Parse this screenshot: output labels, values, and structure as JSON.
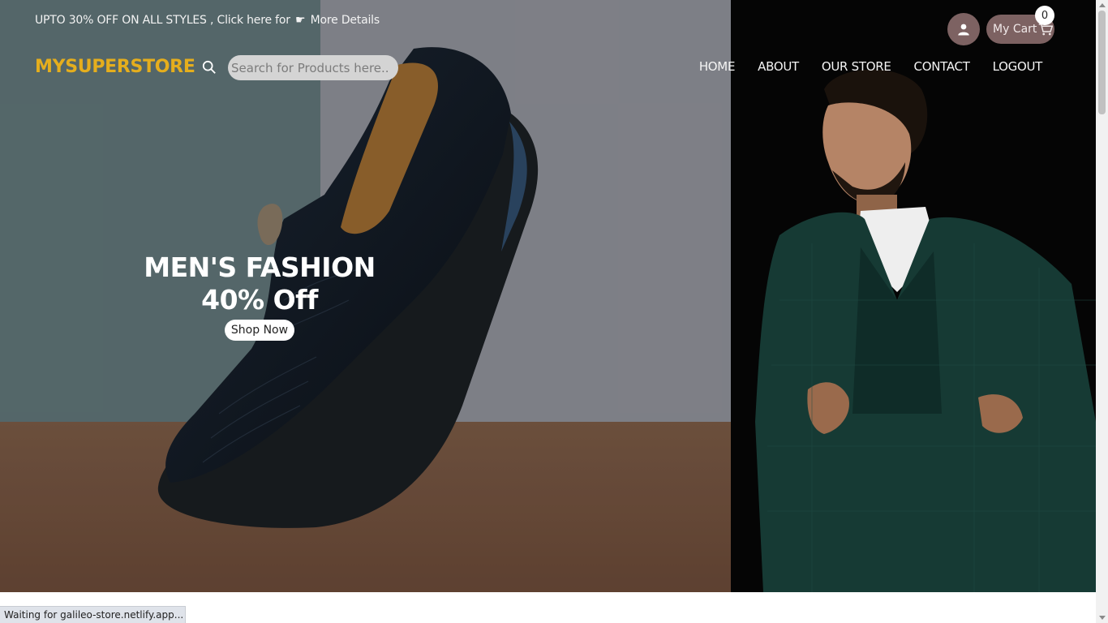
{
  "announcement": {
    "text_before": "UPTO 30% OFF ON ALL STYLES , Click here for",
    "hand_icon": "pointing-hand-icon",
    "text_after": "More Details"
  },
  "header": {
    "brand": "MYSUPERSTORE",
    "search": {
      "placeholder": "Search for Products here..",
      "value": ""
    },
    "nav": [
      "HOME",
      "ABOUT",
      "OUR STORE",
      "CONTACT",
      "LOGOUT"
    ],
    "user_icon": "user-icon",
    "cart": {
      "label": "My Cart",
      "icon": "cart-icon",
      "count": "0"
    }
  },
  "hero": {
    "title": "MEN'S FASHION",
    "subtitle": "40% Off",
    "button": "Shop Now"
  },
  "status_bar": {
    "text": "Waiting for galileo-store.netlify.app..."
  },
  "colors": {
    "brand": "#e5ae1d",
    "header_buttons": "#7d6262",
    "search_bg": "#d4d4d4"
  }
}
